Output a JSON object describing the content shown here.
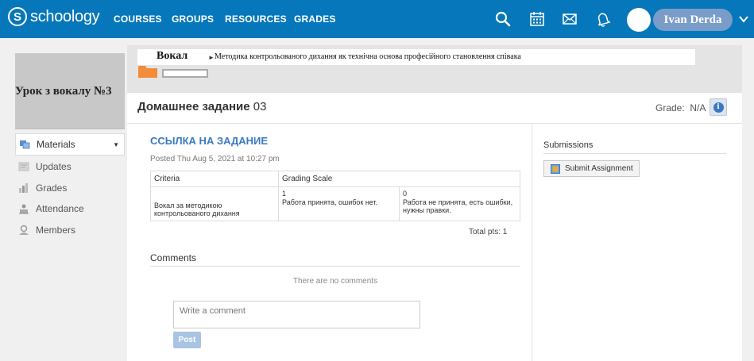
{
  "nav": {
    "logo_text": "schoology",
    "logo_mark": "S",
    "links": [
      "COURSES",
      "GROUPS",
      "RESOURCES",
      "GRADES"
    ],
    "icons": [
      "search-icon",
      "calendar-icon",
      "mail-icon",
      "bell-icon"
    ],
    "user_name": "Ivan Derda",
    "colors": {
      "bar": "#0677ba",
      "user_pill": "#7a9cc8"
    }
  },
  "course": {
    "title": "Урок з вокалу №3",
    "section_title": "Вокал",
    "breadcrumb": "Методика контрольованого дихання як технічна основа професійного становлення співака"
  },
  "sidebar": {
    "items": [
      {
        "label": "Materials",
        "icon": "materials-icon",
        "active": true
      },
      {
        "label": "Updates",
        "icon": "updates-icon",
        "active": false
      },
      {
        "label": "Grades",
        "icon": "grades-icon",
        "active": false
      },
      {
        "label": "Attendance",
        "icon": "attendance-icon",
        "active": false
      },
      {
        "label": "Members",
        "icon": "members-icon",
        "active": false
      }
    ]
  },
  "assignment": {
    "title_prefix": "Домашнее задание",
    "title_number": "03",
    "grade_label": "Grade:",
    "grade_value": "N/A",
    "link_title": "ССЫЛКА НА ЗАДАНИЕ",
    "posted": "Posted Thu Aug 5, 2021 at 10:27 pm"
  },
  "rubric": {
    "headers": [
      "Criteria",
      "Grading Scale"
    ],
    "criterion": "Вокал за методикою контрольованого дихання",
    "levels": [
      {
        "points": "1",
        "description": "Работа принята, ошибок нет."
      },
      {
        "points": "0",
        "description": "Работа не принята, есть ошибки, нужны правки."
      }
    ],
    "total": "Total pts: 1"
  },
  "comments": {
    "heading": "Comments",
    "empty_text": "There are no comments",
    "placeholder": "Write a comment",
    "post_label": "Post"
  },
  "submissions": {
    "heading": "Submissions",
    "button_label": "Submit Assignment"
  }
}
